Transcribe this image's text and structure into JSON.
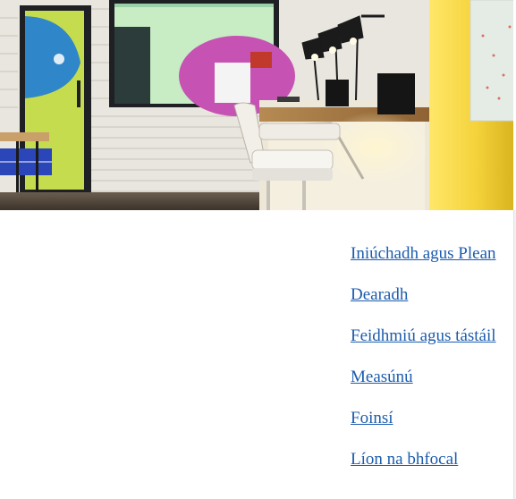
{
  "hero_image": {
    "subject": "office-interior-photo",
    "icon": "photo-icon"
  },
  "nav": {
    "links": [
      {
        "label": "Iniúchadh agus Plean"
      },
      {
        "label": "Dearadh"
      },
      {
        "label": "Feidhmiú agus tástáil"
      },
      {
        "label": "Measúnú"
      },
      {
        "label": "Foinsí"
      },
      {
        "label": "Líon na bhfocal"
      }
    ]
  },
  "colors": {
    "link": "#1b5cad",
    "wall_yellow": "#f4d23a",
    "background": "#ffffff"
  }
}
